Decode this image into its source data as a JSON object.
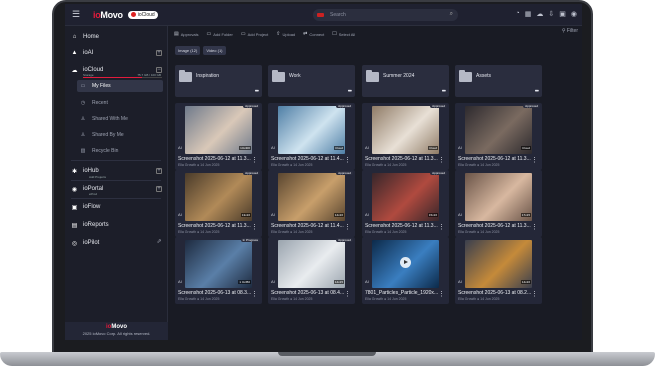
{
  "app": {
    "brand_prefix": "io",
    "brand_suffix": "Movo",
    "chip": "ioCloud",
    "search_placeholder": "Search"
  },
  "topbar_icons": [
    "bell-icon",
    "grid-icon",
    "cloud-upload-icon",
    "cloud-download-icon",
    "camera-icon",
    "record-icon"
  ],
  "sidebar": {
    "home": "Home",
    "ioai": "ioAI",
    "iocloud": "ioCloud",
    "iocloud_sub": "Storage",
    "iocloud_size": "75.7 GB / 100 GB",
    "myfiles": "My Files",
    "recent": "Recent",
    "shared_with_me": "Shared With Me",
    "shared_by_me": "Shared By Me",
    "recycle_bin": "Recycle Bin",
    "iohub": "ioHub",
    "iohub_sub": "Add Projects",
    "ioportal": "ioPortal",
    "ioportal_sub": "eProd",
    "ioflow": "ioFlow",
    "ioreports": "ioReports",
    "iopilot": "ioPilot",
    "footer_brand_prefix": "io",
    "footer_brand_suffix": "Movo",
    "footer_copy": "2025 ioMovo Corp. All rights reserved."
  },
  "toolbar": {
    "approvals": "Approvals",
    "add_folder": "Add Folder",
    "add_project": "Add Project",
    "upload": "Upload",
    "connect": "Connect",
    "select_all": "Select All",
    "filter": "Filter"
  },
  "pills": [
    "Image (12)",
    "Video (1)"
  ],
  "folders": [
    "Inspiration",
    "Work",
    "Summer 2024",
    "Assets"
  ],
  "cards": [
    {
      "title": "Screenshot 2025-06-12 at 11.3...",
      "meta": "Ella Growth  ●  14 Jun 2025",
      "tag": "Approved",
      "dur": "14x400",
      "color": "#6f7a8b",
      "accent": "#d9c8b8"
    },
    {
      "title": "Screenshot 2025-06-12 at 11.4...",
      "meta": "Ella Growth  ●  14 Jun 2025",
      "tag": "Approved",
      "dur": "Cloud",
      "color": "#4f7fa6",
      "accent": "#cfe3ef"
    },
    {
      "title": "Screenshot 2025-06-12 at 11.3...",
      "meta": "Ella Growth  ●  14 Jun 2025",
      "tag": "Approved",
      "dur": "Cloud",
      "color": "#8f7b66",
      "accent": "#e8e0d6"
    },
    {
      "title": "Screenshot 2025-06-12 at 11.3...",
      "meta": "Ella Growth  ●  14 Jun 2025",
      "tag": "Approved",
      "dur": "Cloud",
      "color": "#2d2a2e",
      "accent": "#7a6a60"
    },
    {
      "title": "Screenshot 2025-06-12 at 11.3...",
      "meta": "Ella Growth  ●  14 Jun 2025",
      "tag": "Approved",
      "dur": "13x16",
      "color": "#4a3b2a",
      "accent": "#b18a58"
    },
    {
      "title": "Screenshot 2025-06-12 at 11.4...",
      "meta": "Ella Growth  ●  14 Jun 2025",
      "tag": "Approved",
      "dur": "14x16",
      "color": "#5a4630",
      "accent": "#c89f6b"
    },
    {
      "title": "Screenshot 2025-06-12 at 11.3...",
      "meta": "Ella Growth  ●  14 Jun 2025",
      "tag": "Approved",
      "dur": "15x16",
      "color": "#37262a",
      "accent": "#b04a3f"
    },
    {
      "title": "Screenshot 2025-06-12 at 11.3...",
      "meta": "Ella Growth  ●  14 Jun 2025",
      "tag": "",
      "dur": "17x15",
      "color": "#6a5448",
      "accent": "#d8b8a0"
    },
    {
      "title": "Screenshot 2025-06-13 at 08.3...",
      "meta": "Ella Growth  ●  14 Jun 2025",
      "tag": "In Progress",
      "dur": "1 4x450",
      "color": "#1e2b40",
      "accent": "#5a7fa8"
    },
    {
      "title": "Screenshot 2025-06-13 at 08.4...",
      "meta": "Ella Growth  ●  14 Jun 2025",
      "tag": "Approved",
      "dur": "14x15",
      "color": "#9aa4ae",
      "accent": "#e9ecef"
    },
    {
      "title": "7801_Particles_Particle_1920x...",
      "meta": "Ella Growth  ●  14 Jun 2025",
      "tag": "",
      "dur": "",
      "color": "#0c2a4a",
      "accent": "#3a7ec0",
      "video": true
    },
    {
      "title": "Screenshot 2025-06-13 at 08.2...",
      "meta": "Ella Growth  ●  14 Jun 2025",
      "tag": "",
      "dur": "14x16",
      "color": "#3a3f4e",
      "accent": "#c58a3a"
    }
  ]
}
